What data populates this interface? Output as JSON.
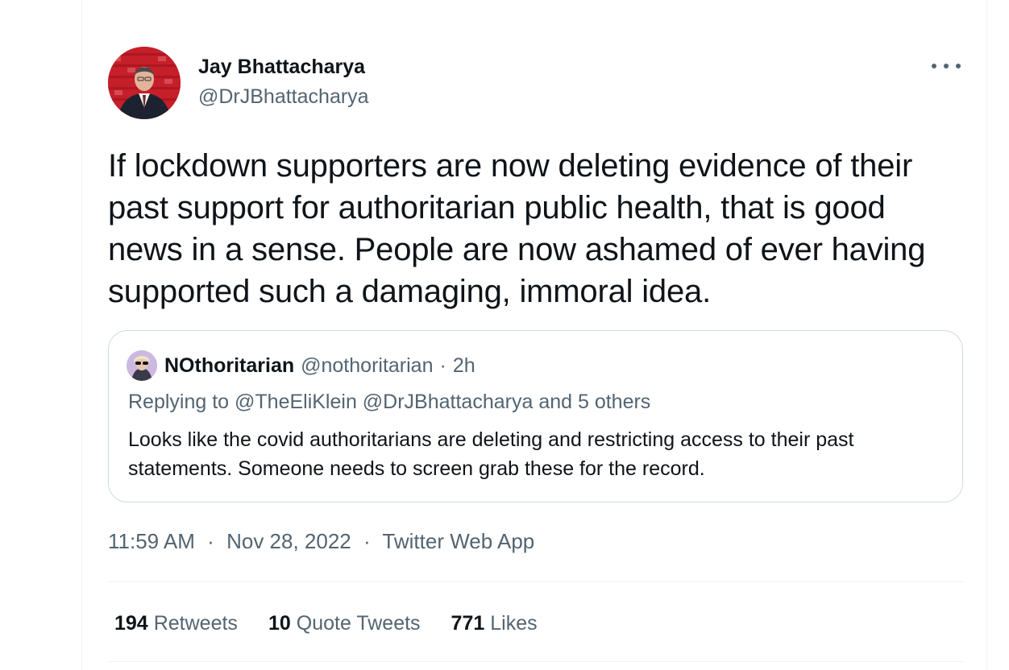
{
  "tweet": {
    "author": {
      "display_name": "Jay Bhattacharya",
      "handle": "@DrJBhattacharya"
    },
    "text": "If lockdown supporters are now deleting evidence of their past support for authoritarian public health, that is good news in a sense. People are now ashamed of ever having supported such a damaging, immoral idea.",
    "quoted": {
      "display_name": "NOthoritarian",
      "handle": "@nothoritarian",
      "dot": "·",
      "time": "2h",
      "replying_to": "Replying to @TheEliKlein @DrJBhattacharya and 5 others",
      "text": "Looks like the covid authoritarians are deleting and restricting access to their past statements. Someone needs to screen grab these for the record."
    },
    "time": "11:59 AM",
    "sep1": "·",
    "date": "Nov 28, 2022",
    "sep2": "·",
    "source": "Twitter Web App",
    "stats": {
      "retweets_count": "194",
      "retweets_label": "Retweets",
      "quotes_count": "10",
      "quotes_label": "Quote Tweets",
      "likes_count": "771",
      "likes_label": "Likes"
    }
  },
  "icons": {
    "more": "more-horizontal-icon"
  },
  "colors": {
    "primary_text": "#0f1419",
    "secondary_text": "#536471",
    "border": "#cfd9de",
    "divider": "#eff3f4",
    "avatar_bg": "#c8202a"
  }
}
